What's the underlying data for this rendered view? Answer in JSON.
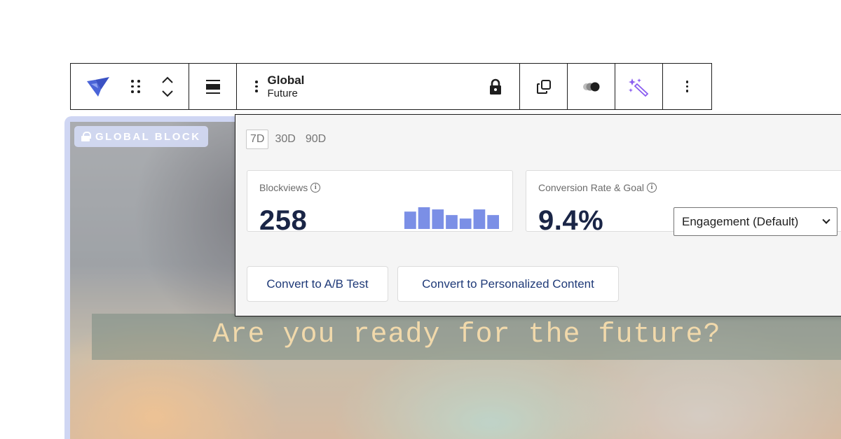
{
  "block": {
    "badge_label": "GLOBAL BLOCK",
    "headline": "Are you ready for the future?"
  },
  "toolbar": {
    "block_name": "Global",
    "block_subtitle": "Future",
    "icons": [
      "logo-icon",
      "drag-handle-icon",
      "move-up-icon",
      "move-down-icon",
      "align-icon",
      "more-options-icon",
      "lock-icon",
      "duplicate-icon",
      "toggle-visibility-icon",
      "magic-wand-icon",
      "kebab-menu-icon"
    ]
  },
  "popover": {
    "ranges": [
      "7D",
      "30D",
      "90D"
    ],
    "active_range": "7D",
    "blockviews": {
      "label": "Blockviews",
      "value": "258",
      "trend": [
        0.8,
        1.0,
        0.9,
        0.64,
        0.48,
        0.9,
        0.64
      ]
    },
    "conversion": {
      "label": "Conversion Rate & Goal",
      "value": "9.4%",
      "goal_selected": "Engagement (Default)"
    },
    "buttons": {
      "ab_test": "Convert to A/B Test",
      "personalized": "Convert to Personalized Content"
    }
  },
  "colors": {
    "accent_bar": "#7b8fe6",
    "logo": "#4a64d8",
    "magic": "#8a5cf0",
    "button_text": "#1f3a78",
    "big_number": "#1a2546"
  }
}
